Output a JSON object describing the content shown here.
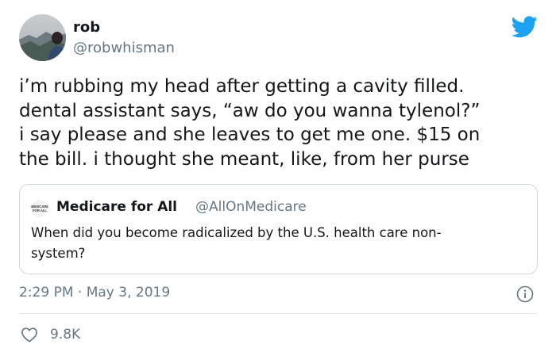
{
  "author": {
    "name": "rob",
    "handle": "@robwhisman"
  },
  "tweet_text_lines": [
    "i’m rubbing my head after getting a cavity filled.",
    "dental assistant says, “aw do you wanna tylenol?”",
    "i say please and she leaves to get me one. $15 on",
    "the bill. i thought she meant, like, from her purse"
  ],
  "quoted": {
    "name": "Medicare for All",
    "handle": "@AllOnMedicare",
    "avatar_text": "MEDICARE FOR ALL",
    "text_lines": [
      "When did you become radicalized by the U.S. health care non-",
      "system?"
    ]
  },
  "timestamp": "2:29 PM · May 3, 2019",
  "likes": "9.8K",
  "icons": {
    "logo": "twitter-bird-icon",
    "info": "info-icon",
    "like": "heart-icon"
  },
  "colors": {
    "brand": "#1da1f2",
    "secondary_text": "#657786",
    "border": "#ccd6dd"
  }
}
